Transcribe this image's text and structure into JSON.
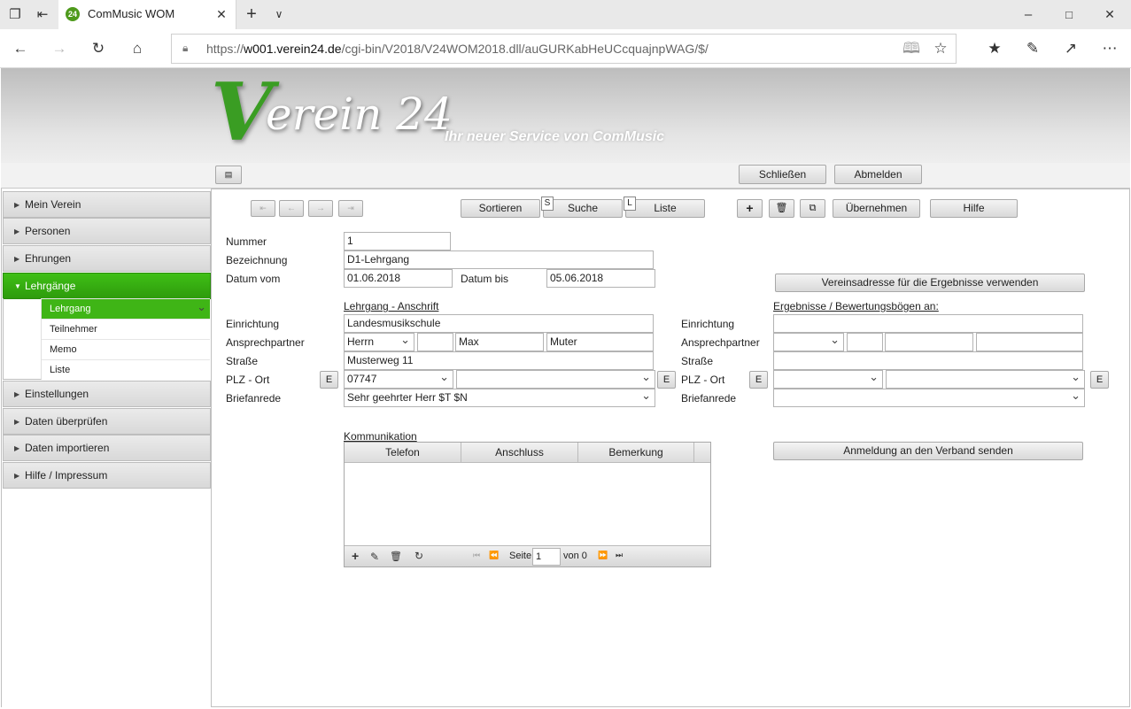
{
  "browser": {
    "tab_title": "ComMusic WOM",
    "favicon": "24",
    "url_host": "w001.verein24.de",
    "url_path": "/cgi-bin/V2018/V24WOM2018.dll/auGURKabHeUCcquajnpWAG/$/",
    "url_prefix": "https://"
  },
  "header": {
    "logo_v": "V",
    "logo_text": "erein 24",
    "slogan": "Ihr neuer Service von ComMusic",
    "close_label": "Schließen",
    "logout_label": "Abmelden"
  },
  "sidebar": {
    "items": [
      "Mein Verein",
      "Personen",
      "Ehrungen",
      "Lehrgänge",
      "Einstellungen",
      "Daten überprüfen",
      "Daten importieren",
      "Hilfe / Impressum"
    ],
    "subitems": [
      "Lehrgang",
      "Teilnehmer",
      "Memo",
      "Liste"
    ]
  },
  "toolbar": {
    "sort": "Sortieren",
    "search": "Suche",
    "search_key": "S",
    "list": "Liste",
    "list_key": "L",
    "apply": "Übernehmen",
    "help": "Hilfe"
  },
  "form": {
    "nummer_label": "Nummer",
    "nummer": "1",
    "bez_label": "Bezeichnung",
    "bez": "D1-Lehrgang",
    "datum_vom_label": "Datum vom",
    "datum_vom": "01.06.2018",
    "datum_bis_label": "Datum bis",
    "datum_bis": "05.06.2018",
    "use_address_btn": "Vereinsadresse für die Ergebnisse verwenden",
    "left_head": "Lehrgang - Anschrift",
    "right_head": "Ergebnisse / Bewertungsbögen an:",
    "einrichtung_label": "Einrichtung",
    "einrichtung": "Landesmusikschule",
    "ansprech_label": "Ansprechpartner",
    "anrede": "Herrn",
    "vorname": "Max",
    "nachname": "Muter",
    "strasse_label": "Straße",
    "strasse": "Musterweg 11",
    "plz_label": "PLZ - Ort",
    "plz": "07747",
    "e_label": "E",
    "brief_label": "Briefanrede",
    "brief": "Sehr geehrter Herr $T $N",
    "komm_head": "Kommunikation",
    "col_tel": "Telefon",
    "col_ans": "Anschluss",
    "col_bem": "Bemerkung",
    "page_label": "Seite",
    "page_value": "1",
    "page_of": "von 0",
    "send_btn": "Anmeldung an den Verband senden"
  }
}
